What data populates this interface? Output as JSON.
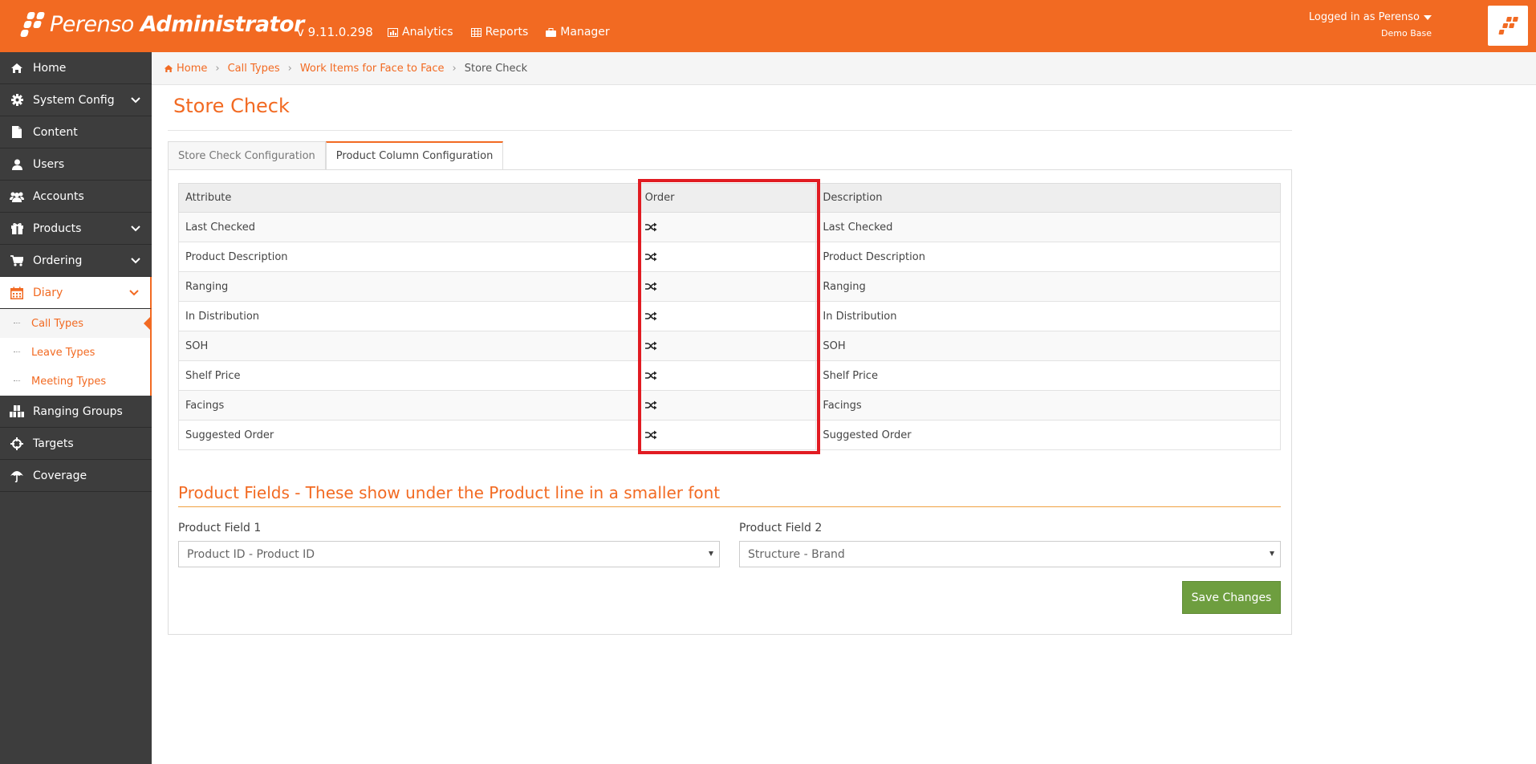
{
  "header": {
    "app_name_light": "Perenso",
    "app_name_bold": "Administrator",
    "version": "v 9.11.0.298",
    "nav": [
      {
        "label": "Analytics",
        "icon": "bar-chart-icon"
      },
      {
        "label": "Reports",
        "icon": "table-icon"
      },
      {
        "label": "Manager",
        "icon": "briefcase-icon"
      }
    ],
    "user": {
      "logged_in": "Logged in as Perenso",
      "database": "Demo Base"
    }
  },
  "sidebar": {
    "items": [
      {
        "label": "Home",
        "icon": "home-icon"
      },
      {
        "label": "System Config",
        "icon": "gear-icon"
      },
      {
        "label": "Content",
        "icon": "file-icon"
      },
      {
        "label": "Users",
        "icon": "user-icon"
      },
      {
        "label": "Accounts",
        "icon": "users-icon"
      },
      {
        "label": "Products",
        "icon": "gift-icon"
      },
      {
        "label": "Ordering",
        "icon": "cart-icon"
      },
      {
        "label": "Diary",
        "icon": "calendar-icon"
      },
      {
        "label": "Ranging Groups",
        "icon": "cubes-icon"
      },
      {
        "label": "Targets",
        "icon": "crosshairs-icon"
      },
      {
        "label": "Coverage",
        "icon": "umbrella-icon"
      }
    ],
    "diary_sub": [
      "Call Types",
      "Leave Types",
      "Meeting Types"
    ]
  },
  "breadcrumb": [
    "Home",
    "Call Types",
    "Work Items for Face to Face",
    "Store Check"
  ],
  "page": {
    "title": "Store Check",
    "tabs": [
      "Store Check Configuration",
      "Product Column Configuration"
    ],
    "active_tab": "Product Column Configuration"
  },
  "table": {
    "headers": [
      "Attribute",
      "Order",
      "Description"
    ],
    "rows": [
      {
        "attribute": "Last Checked",
        "description": "Last Checked"
      },
      {
        "attribute": "Product Description",
        "description": "Product Description"
      },
      {
        "attribute": "Ranging",
        "description": "Ranging"
      },
      {
        "attribute": "In Distribution",
        "description": "In Distribution"
      },
      {
        "attribute": "SOH",
        "description": "SOH"
      },
      {
        "attribute": "Shelf Price",
        "description": "Shelf Price"
      },
      {
        "attribute": "Facings",
        "description": "Facings"
      },
      {
        "attribute": "Suggested Order",
        "description": "Suggested Order"
      }
    ],
    "order_icon": "shuffle-icon"
  },
  "product_fields": {
    "title": "Product Fields - These show under the Product line in a smaller font",
    "field1_label": "Product Field 1",
    "field1_value": "Product ID - Product ID",
    "field2_label": "Product Field 2",
    "field2_value": "Structure - Brand"
  },
  "save_label": "Save Changes",
  "colors": {
    "brand": "#f26a22",
    "sidebar": "#3d3d3d",
    "save": "#6e9e3f",
    "highlight": "#e11b22"
  }
}
